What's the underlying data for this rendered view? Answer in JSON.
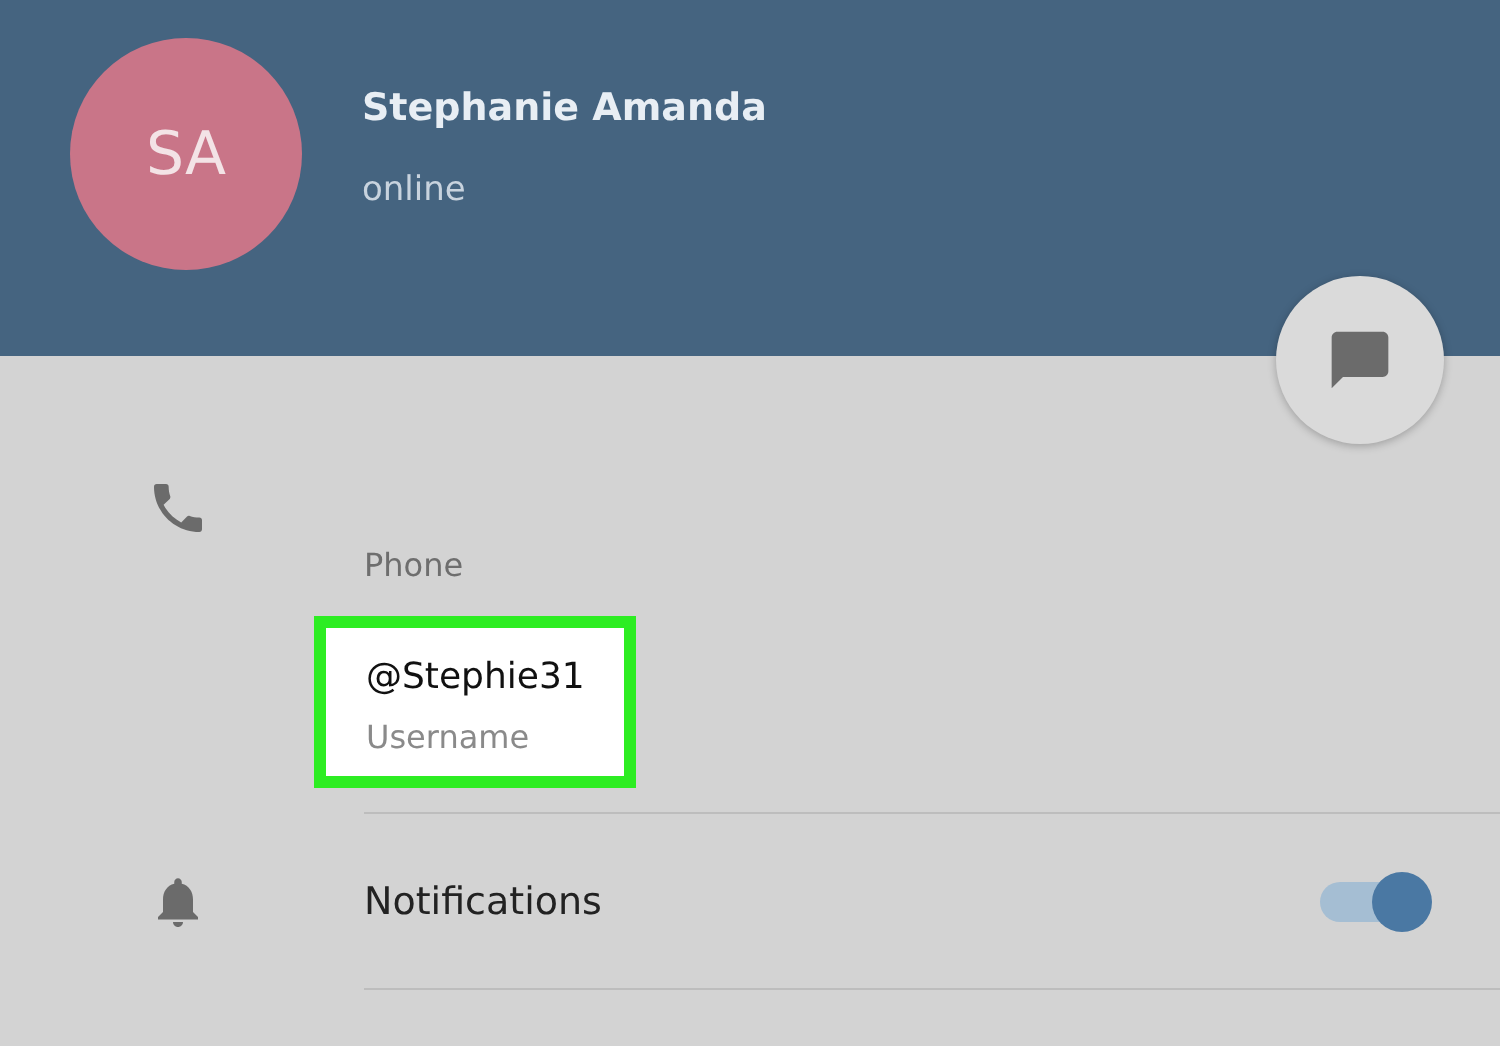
{
  "profile": {
    "initials": "SA",
    "name": "Stephanie Amanda",
    "status": "online"
  },
  "info": {
    "phone_label": "Phone",
    "username": "@Stephie31",
    "username_label": "Username",
    "highlighted": true
  },
  "notifications": {
    "label": "Notifications",
    "on": true
  }
}
